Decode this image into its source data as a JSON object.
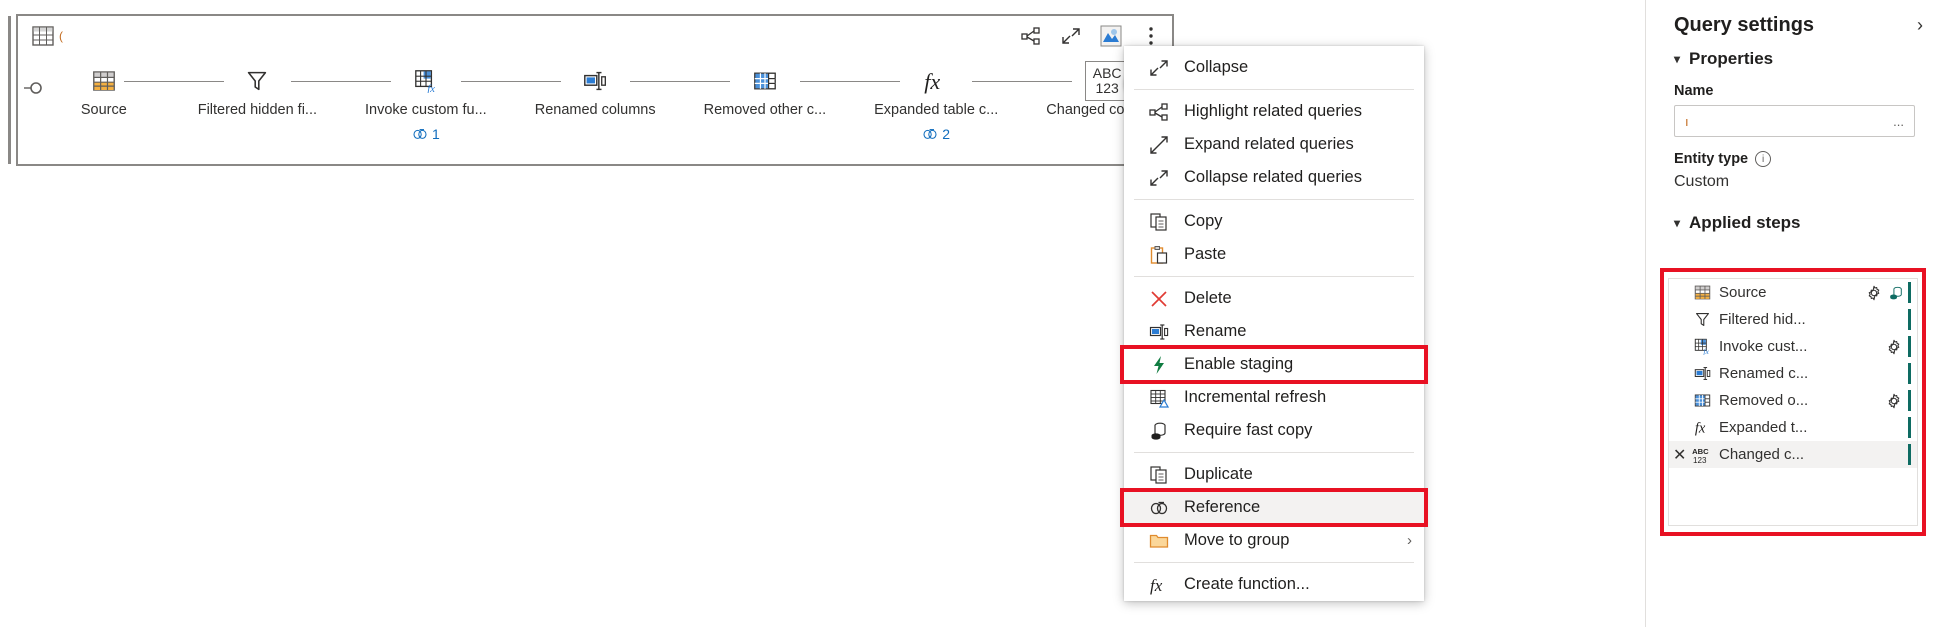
{
  "app": {
    "colors": {
      "accent_blue": "#0f6cbd",
      "highlight_red": "#e81123",
      "step_bar_teal": "#0e6b62",
      "orange": "#c26b1f",
      "panel_border": "#8a8886"
    }
  },
  "diagram": {
    "query_title": "(",
    "toolbar": [
      {
        "name": "highlight-related-queries-icon",
        "label": "Highlight related queries"
      },
      {
        "name": "collapse-icon",
        "label": "Collapse"
      },
      {
        "name": "query-thumbnail-icon",
        "label": "Query"
      },
      {
        "name": "more-options-icon",
        "label": "More options"
      }
    ],
    "add_step_label": "+",
    "add_step_overflow": "...",
    "steps": [
      {
        "label": "Source",
        "icon": "source-table-icon",
        "refs": ""
      },
      {
        "label": "Filtered hidden fi...",
        "icon": "filter-icon",
        "refs": ""
      },
      {
        "label": "Invoke custom fu...",
        "icon": "invoke-function-icon",
        "refs": "1"
      },
      {
        "label": "Renamed columns",
        "icon": "rename-icon",
        "refs": ""
      },
      {
        "label": "Removed other c...",
        "icon": "table-columns-icon",
        "refs": ""
      },
      {
        "label": "Expanded table c...",
        "icon": "fx-icon",
        "refs": "2"
      },
      {
        "label": "Changed column...",
        "icon": "abc-123-icon",
        "refs": ""
      }
    ],
    "abc_icon": {
      "top": "ABC",
      "bottom": "123"
    }
  },
  "context_menu": {
    "items": [
      {
        "label": "Collapse",
        "icon": "collapse-icon",
        "sep_after": true,
        "highlight": false,
        "hovered": false,
        "submenu": ""
      },
      {
        "label": "Highlight related queries",
        "icon": "highlight-related-queries-icon",
        "sep_after": false,
        "highlight": false,
        "hovered": false,
        "submenu": ""
      },
      {
        "label": "Expand related queries",
        "icon": "expand-related-queries-icon",
        "sep_after": false,
        "highlight": false,
        "hovered": false,
        "submenu": ""
      },
      {
        "label": "Collapse related queries",
        "icon": "collapse-related-queries-icon",
        "sep_after": true,
        "highlight": false,
        "hovered": false,
        "submenu": ""
      },
      {
        "label": "Copy",
        "icon": "copy-icon",
        "sep_after": false,
        "highlight": false,
        "hovered": false,
        "submenu": ""
      },
      {
        "label": "Paste",
        "icon": "paste-icon",
        "sep_after": true,
        "highlight": false,
        "hovered": false,
        "submenu": ""
      },
      {
        "label": "Delete",
        "icon": "delete-x-icon",
        "sep_after": false,
        "highlight": false,
        "hovered": false,
        "submenu": ""
      },
      {
        "label": "Rename",
        "icon": "rename-icon",
        "sep_after": false,
        "highlight": false,
        "hovered": false,
        "submenu": ""
      },
      {
        "label": "Enable staging",
        "icon": "lightning-bolt-icon",
        "sep_after": false,
        "highlight": true,
        "hovered": false,
        "submenu": ""
      },
      {
        "label": "Incremental refresh",
        "icon": "incremental-refresh-icon",
        "sep_after": false,
        "highlight": false,
        "hovered": false,
        "submenu": ""
      },
      {
        "label": "Require fast copy",
        "icon": "fast-copy-icon",
        "sep_after": true,
        "highlight": false,
        "hovered": false,
        "submenu": ""
      },
      {
        "label": "Duplicate",
        "icon": "duplicate-icon",
        "sep_after": false,
        "highlight": false,
        "hovered": false,
        "submenu": ""
      },
      {
        "label": "Reference",
        "icon": "reference-icon",
        "sep_after": false,
        "highlight": true,
        "hovered": true,
        "submenu": ""
      },
      {
        "label": "Move to group",
        "icon": "folder-icon",
        "sep_after": true,
        "highlight": false,
        "hovered": false,
        "submenu": "›"
      },
      {
        "label": "Create function...",
        "icon": "fx-icon",
        "sep_after": false,
        "highlight": false,
        "hovered": false,
        "submenu": ""
      }
    ]
  },
  "query_settings": {
    "title": "Query settings",
    "collapse_icon": "›",
    "properties_section": "Properties",
    "name_label": "Name",
    "name_value": "ı",
    "name_overflow": "...",
    "entity_type_label": "Entity type",
    "entity_type_value": "Custom",
    "applied_steps_section": "Applied steps",
    "steps": [
      {
        "label": "Source",
        "icon": "source-table-icon",
        "gear": true,
        "stage": true,
        "delete": false,
        "selected": false
      },
      {
        "label": "Filtered hid...",
        "icon": "filter-icon",
        "gear": false,
        "stage": false,
        "delete": false,
        "selected": false
      },
      {
        "label": "Invoke cust...",
        "icon": "invoke-function-icon",
        "gear": true,
        "stage": false,
        "delete": false,
        "selected": false
      },
      {
        "label": "Renamed c...",
        "icon": "rename-icon",
        "gear": false,
        "stage": false,
        "delete": false,
        "selected": false
      },
      {
        "label": "Removed o...",
        "icon": "table-columns-icon",
        "gear": true,
        "stage": false,
        "delete": false,
        "selected": false
      },
      {
        "label": "Expanded t...",
        "icon": "fx-icon",
        "gear": false,
        "stage": false,
        "delete": false,
        "selected": false
      },
      {
        "label": "Changed c...",
        "icon": "abc-123-icon",
        "gear": false,
        "stage": false,
        "delete": true,
        "selected": true
      }
    ]
  }
}
